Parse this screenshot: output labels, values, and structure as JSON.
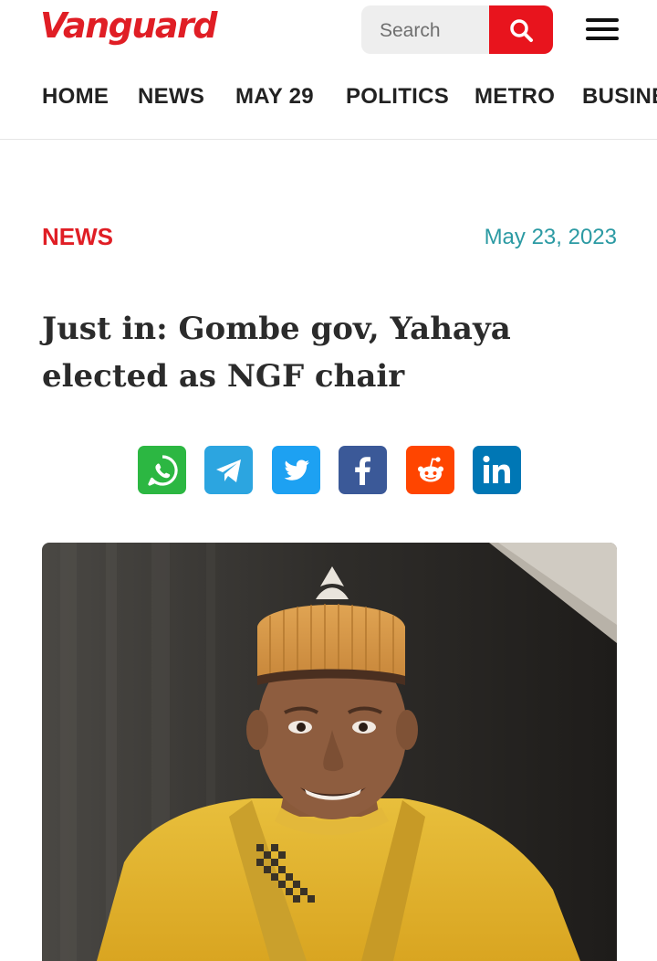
{
  "header": {
    "logo": "Vanguard",
    "search_placeholder": "Search",
    "nav": [
      "HOME",
      "NEWS",
      "MAY 29",
      "POLITICS",
      "METRO",
      "BUSINESS"
    ]
  },
  "article": {
    "category": "NEWS",
    "date": "May 23, 2023",
    "title": "Just in: Gombe gov, Yahaya elected as NGF chair"
  },
  "share_icons": [
    {
      "icon": "whatsapp-icon",
      "color": "#2cb742"
    },
    {
      "icon": "telegram-icon",
      "color": "#2ca5e0"
    },
    {
      "icon": "twitter-icon",
      "color": "#1da1f2"
    },
    {
      "icon": "facebook-icon",
      "color": "#3b5998"
    },
    {
      "icon": "reddit-icon",
      "color": "#ff4500"
    },
    {
      "icon": "linkedin-icon",
      "color": "#0077b5"
    }
  ],
  "colors": {
    "brand": "#e01e25",
    "date": "#2b9aa3"
  }
}
